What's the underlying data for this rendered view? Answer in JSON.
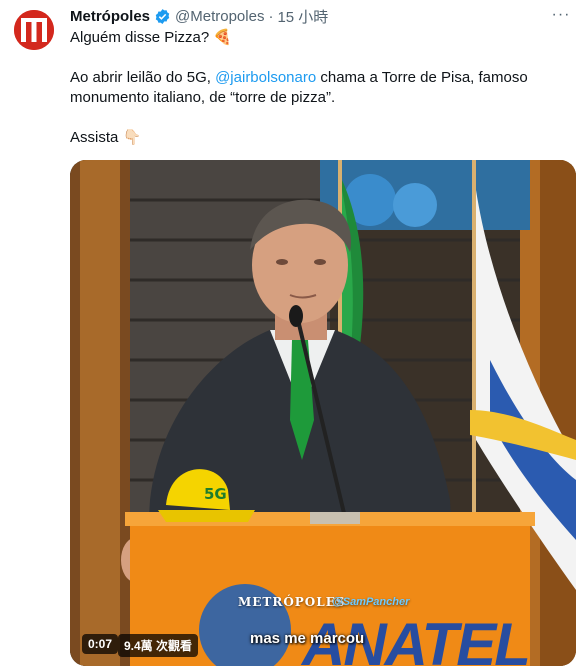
{
  "tweet": {
    "author_name": "Metrópoles",
    "handle": "@Metropoles",
    "separator": "·",
    "time": "15 小時",
    "more_glyph": "···",
    "line1": "Alguém disse Pizza? 🍕",
    "line2_before": "Ao abrir leilão do 5G, ",
    "mention": "@jairbolsonaro",
    "line2_after": " chama a Torre de Pisa, famoso monumento italiano, de “torre de pizza”.",
    "line3": "Assista 👇🏻"
  },
  "video": {
    "duration": "0:07",
    "views": "9.4萬 次觀看",
    "subtitle": "mas me marcou",
    "brand_overlay": "METRÓPOLES",
    "credit_overlay": "@SamPancher",
    "podium_text": "ANATEL",
    "hat_text": "5G"
  },
  "colors": {
    "brand_red": "#d3281d",
    "verified_blue": "#1d9bf0",
    "link_blue": "#1d9bf0",
    "podium_orange": "#f08a16",
    "tie_green": "#1e9a3a"
  },
  "icons": {
    "avatar": "metropoles-logo-icon",
    "verified": "verified-badge-icon",
    "more": "more-options-icon"
  }
}
